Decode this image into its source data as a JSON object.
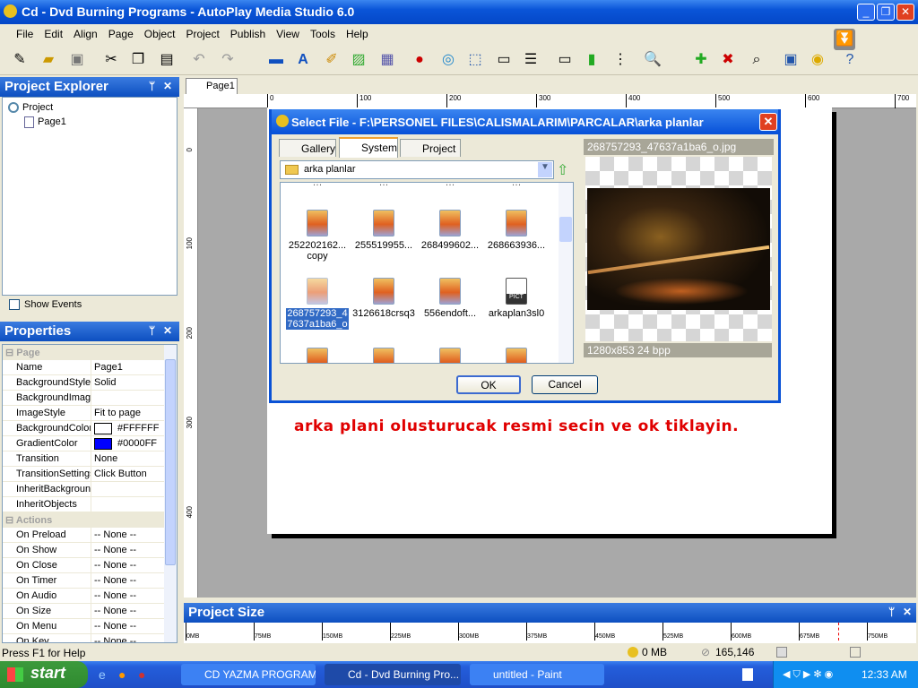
{
  "window": {
    "title": "Cd - Dvd Burning Programs - AutoPlay Media Studio 6.0",
    "min": "_",
    "max": "❐",
    "close": "✕"
  },
  "menu": [
    "File",
    "Edit",
    "Align",
    "Page",
    "Object",
    "Project",
    "Publish",
    "View",
    "Tools",
    "Help"
  ],
  "project_explorer": {
    "title": "Project Explorer",
    "pin": "ᛘ",
    "close": "✕",
    "tree": {
      "root": "Project",
      "child": "Page1"
    },
    "show_events": "Show Events",
    "show_events_checked": false
  },
  "properties": {
    "title": "Properties",
    "categories": [
      {
        "name": "Page",
        "rows": [
          {
            "k": "Name",
            "v": "Page1"
          },
          {
            "k": "BackgroundStyle",
            "v": "Solid"
          },
          {
            "k": "BackgroundImage",
            "v": ""
          },
          {
            "k": "ImageStyle",
            "v": "Fit to page"
          },
          {
            "k": "BackgroundColor",
            "v": "#FFFFFF",
            "swatch": "#FFFFFF"
          },
          {
            "k": "GradientColor",
            "v": "#0000FF",
            "swatch": "#0000FF"
          },
          {
            "k": "Transition",
            "v": "None"
          },
          {
            "k": "TransitionSettings",
            "v": "Click Button"
          },
          {
            "k": "InheritBackground",
            "v": ""
          },
          {
            "k": "InheritObjects",
            "v": ""
          }
        ]
      },
      {
        "name": "Actions",
        "rows": [
          {
            "k": "On Preload",
            "v": "-- None --"
          },
          {
            "k": "On Show",
            "v": "-- None --"
          },
          {
            "k": "On Close",
            "v": "-- None --"
          },
          {
            "k": "On Timer",
            "v": "-- None --"
          },
          {
            "k": "On Audio",
            "v": "-- None --"
          },
          {
            "k": "On Size",
            "v": "-- None --"
          },
          {
            "k": "On Menu",
            "v": "-- None --"
          },
          {
            "k": "On Key",
            "v": "-- None --"
          }
        ]
      }
    ]
  },
  "editor": {
    "tab": "Page1",
    "ruler_top": [
      "0",
      "100",
      "200",
      "300",
      "400",
      "500",
      "600",
      "700"
    ],
    "ruler_left": [
      "0",
      "100",
      "200",
      "300",
      "400"
    ],
    "hint": "arka plani olusturucak resmi secin ve ok tiklayin.",
    "hint_color": "#E00000"
  },
  "dialog": {
    "title": "Select File - F:\\PERSONEL FILES\\CALISMALARIM\\PARCALAR\\arka planlar",
    "tabs": [
      "Gallery",
      "System",
      "Project"
    ],
    "active_tab": "System",
    "folder": "arka planlar",
    "files": [
      {
        "name": "252202162...",
        "sub": "copy"
      },
      {
        "name": "255519955..."
      },
      {
        "name": "268499602..."
      },
      {
        "name": "268663936..."
      },
      {
        "name": "268757293_47637a1ba6_o",
        "selected": true
      },
      {
        "name": "3126618crsq3"
      },
      {
        "name": "556endoft..."
      },
      {
        "name": "arkaplan3sl0",
        "type": "PICT"
      }
    ],
    "preview_name": "268757293_47637a1ba6_o.jpg",
    "preview_info": "1280x853 24 bpp",
    "ok": "OK",
    "cancel": "Cancel"
  },
  "project_size": {
    "title": "Project Size",
    "ticks": [
      "0MB",
      "75MB",
      "150MB",
      "225MB",
      "300MB",
      "375MB",
      "450MB",
      "525MB",
      "600MB",
      "675MB",
      "750MB"
    ]
  },
  "status": {
    "help": "Press F1 for Help",
    "size": "0 MB",
    "count": "165,146"
  },
  "taskbar": {
    "start": "start",
    "tasks": [
      "CD YAZMA PROGRAM...",
      "Cd - Dvd Burning Pro...",
      "untitled - Paint"
    ],
    "active_task": 1,
    "clock": "12:33 AM"
  }
}
